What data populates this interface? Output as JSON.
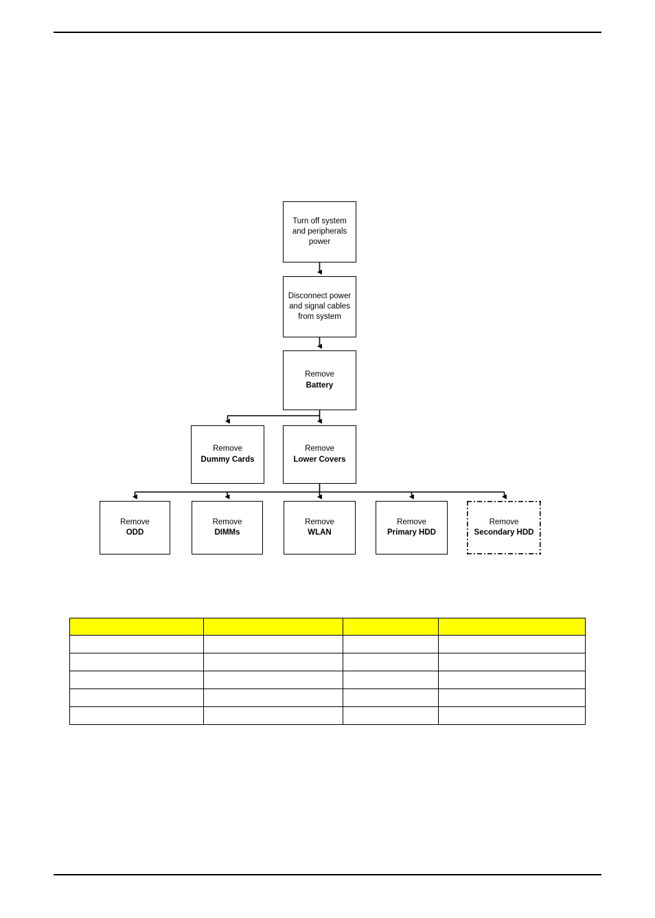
{
  "page": {
    "background_color": "#ffffff",
    "text_color": "#000000",
    "header_rule": "",
    "footer_rule": ""
  },
  "flowchart": {
    "type": "flowchart",
    "orientation": "top-down",
    "accent_color": "#000000",
    "nodes": [
      {
        "id": "power-off",
        "line1": "Turn off system",
        "line2": "and peripherals",
        "line3": "power",
        "bold_lines": [],
        "border": "solid"
      },
      {
        "id": "disconnect",
        "line1": "Disconnect power",
        "line2": "and signal cables",
        "line3": "from system",
        "bold_lines": [],
        "border": "solid"
      },
      {
        "id": "battery",
        "line1": "Remove",
        "line2": "Battery",
        "bold_lines": [
          "line2"
        ],
        "border": "solid"
      },
      {
        "id": "dummy-cards",
        "line1": "Remove",
        "line2": "Dummy Cards",
        "bold_lines": [
          "line2"
        ],
        "border": "solid"
      },
      {
        "id": "lower-covers",
        "line1": "Remove",
        "line2": "Lower Covers",
        "bold_lines": [
          "line2"
        ],
        "border": "solid"
      },
      {
        "id": "odd",
        "line1": "Remove",
        "line2": "ODD",
        "bold_lines": [
          "line2"
        ],
        "border": "solid"
      },
      {
        "id": "dimms",
        "line1": "Remove",
        "line2": "DIMMs",
        "bold_lines": [
          "line2"
        ],
        "border": "solid"
      },
      {
        "id": "wlan",
        "line1": "Remove",
        "line2": "WLAN",
        "bold_lines": [
          "line2"
        ],
        "border": "solid"
      },
      {
        "id": "primary-hdd",
        "line1": "Remove",
        "line2": "Primary HDD",
        "bold_lines": [
          "line2"
        ],
        "border": "solid"
      },
      {
        "id": "secondary-hdd",
        "line1": "Remove",
        "line2": "Secondary HDD",
        "bold_lines": [
          "line2"
        ],
        "border": "dash-dot"
      }
    ],
    "edges": [
      {
        "from": "power-off",
        "to": "disconnect",
        "style": "arrow-down"
      },
      {
        "from": "disconnect",
        "to": "battery",
        "style": "arrow-down"
      },
      {
        "from": "battery",
        "to": "lower-covers",
        "style": "arrow-down"
      },
      {
        "from": "battery",
        "to": "dummy-cards",
        "style": "elbow-left-arrow-down"
      },
      {
        "from": "lower-covers",
        "to": "odd",
        "style": "bus-arrow-down"
      },
      {
        "from": "lower-covers",
        "to": "dimms",
        "style": "bus-arrow-down"
      },
      {
        "from": "lower-covers",
        "to": "wlan",
        "style": "bus-arrow-down"
      },
      {
        "from": "lower-covers",
        "to": "primary-hdd",
        "style": "bus-arrow-down"
      },
      {
        "from": "lower-covers",
        "to": "secondary-hdd",
        "style": "bus-arrow-down"
      }
    ]
  },
  "table": {
    "header_background": "#ffff00",
    "border_color": "#000000",
    "columns": [
      "",
      "",
      "",
      ""
    ],
    "rows": [
      [
        "",
        "",
        "",
        ""
      ],
      [
        "",
        "",
        "",
        ""
      ],
      [
        "",
        "",
        "",
        ""
      ],
      [
        "",
        "",
        "",
        ""
      ],
      [
        "",
        "",
        "",
        ""
      ]
    ]
  }
}
